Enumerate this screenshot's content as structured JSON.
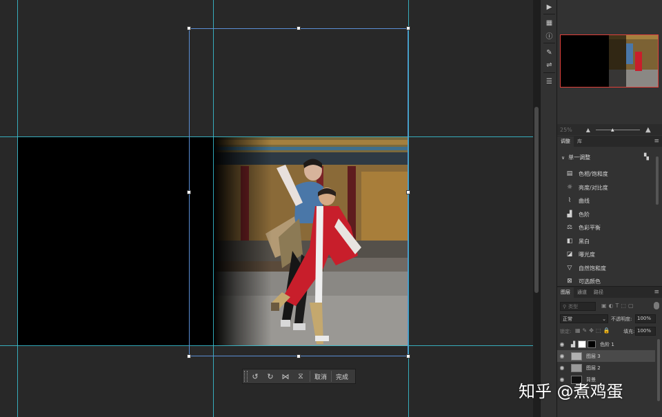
{
  "toolbar": {
    "cancel_label": "取消",
    "done_label": "完成",
    "rotate_ccw_icon": "rotate-ccw",
    "rotate_cw_icon": "rotate-cw",
    "flip_h_icon": "flip-horizontal",
    "flip_v_icon": "flip-vertical"
  },
  "navigator": {
    "zoom": "25%"
  },
  "adjustments": {
    "tabs": [
      "调整",
      "库"
    ],
    "section_label": "单一调整",
    "items": [
      {
        "label": "色相/饱和度",
        "icon": "hue-saturation-icon"
      },
      {
        "label": "亮度/对比度",
        "icon": "brightness-contrast-icon"
      },
      {
        "label": "曲线",
        "icon": "curves-icon"
      },
      {
        "label": "色阶",
        "icon": "levels-icon"
      },
      {
        "label": "色彩平衡",
        "icon": "color-balance-icon"
      },
      {
        "label": "黑白",
        "icon": "black-white-icon"
      },
      {
        "label": "曝光度",
        "icon": "exposure-icon"
      },
      {
        "label": "自然饱和度",
        "icon": "vibrance-icon"
      },
      {
        "label": "可选颜色",
        "icon": "selective-color-icon"
      }
    ]
  },
  "layers": {
    "tabs": [
      "图层",
      "通道",
      "路径"
    ],
    "search_placeholder": "类型",
    "blend_mode": "正常",
    "opacity_label": "不透明度:",
    "opacity_value": "100%",
    "lock_label": "锁定:",
    "fill_label": "填充:",
    "fill_value": "100%",
    "rows": [
      {
        "name": "色阶 1"
      },
      {
        "name": "图层 3"
      },
      {
        "name": "图层 2"
      },
      {
        "name": "背景"
      }
    ]
  },
  "watermark": "知乎 @煮鸡蛋",
  "colors": {
    "guide": "#39c6d8",
    "transform_box": "#5b8fd6",
    "nav_frame": "#e2403a",
    "selected_layer": "#4a4a4a"
  }
}
